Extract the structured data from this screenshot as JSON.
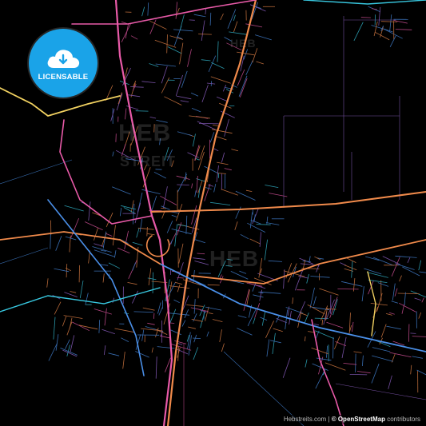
{
  "badge": {
    "label": "LICENSABLE",
    "icon": "cloud-download-icon",
    "color": "#1aa3e8"
  },
  "watermarks": {
    "main": "HEB",
    "secondary": "STREIT"
  },
  "attribution": {
    "site": "Hebstreits.com",
    "separator": "|",
    "copyright": "© OpenStreetMap",
    "suffix": "contributors"
  },
  "palette": {
    "background": "#000000",
    "road_orange": "#f08a4b",
    "road_pink": "#e85aa8",
    "road_blue": "#4a8fe8",
    "road_cyan": "#38c8e0",
    "road_yellow": "#f0d060",
    "road_purple": "#9c6ad8"
  }
}
